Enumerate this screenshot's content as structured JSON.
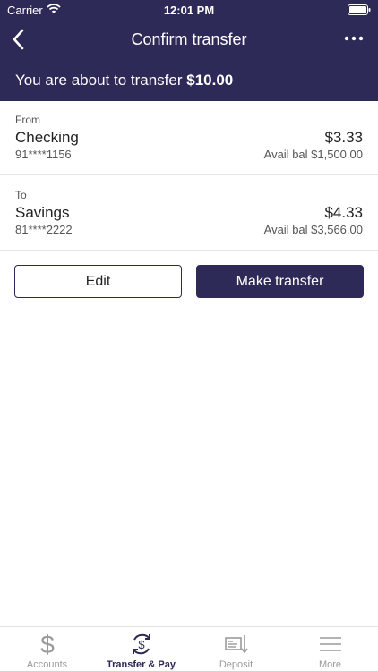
{
  "status_bar": {
    "carrier": "Carrier",
    "time": "12:01 PM"
  },
  "nav": {
    "title": "Confirm transfer"
  },
  "summary": {
    "prefix": "You are about to transfer",
    "amount": "$10.00"
  },
  "from": {
    "label": "From",
    "name": "Checking",
    "number": "91****1156",
    "amount": "$3.33",
    "avail": "Avail bal $1,500.00"
  },
  "to": {
    "label": "To",
    "name": "Savings",
    "number": "81****2222",
    "amount": "$4.33",
    "avail": "Avail bal $3,566.00"
  },
  "actions": {
    "edit_label": "Edit",
    "transfer_label": "Make transfer"
  },
  "tabs": [
    {
      "label": "Accounts",
      "icon": "dollar-icon"
    },
    {
      "label": "Transfer & Pay",
      "icon": "transfer-pay-icon"
    },
    {
      "label": "Deposit",
      "icon": "check-deposit-icon"
    },
    {
      "label": "More",
      "icon": "hamburger-menu-icon"
    }
  ],
  "colors": {
    "brand": "#2e2a57",
    "inactive": "#9a9a9a"
  }
}
